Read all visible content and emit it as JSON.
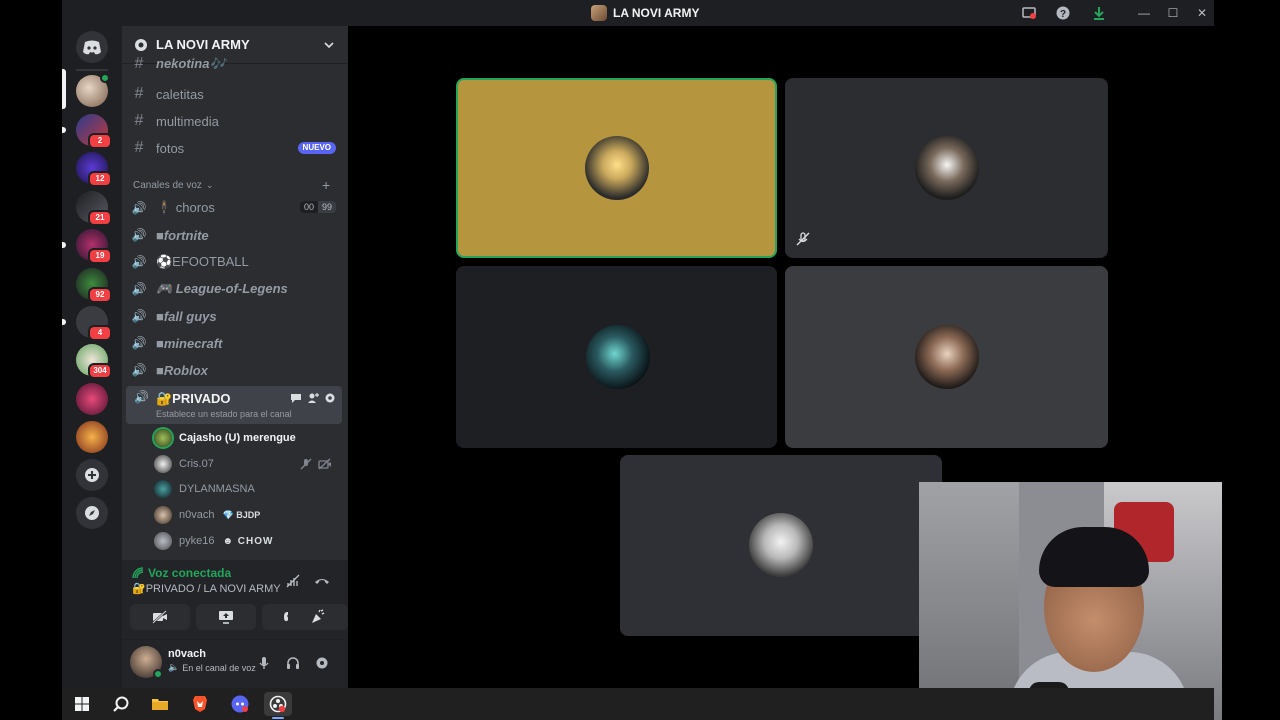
{
  "window": {
    "title": "LA NOVI ARMY"
  },
  "server": {
    "name": "LA NOVI ARMY"
  },
  "rail": {
    "servers": [
      {
        "name": "server-1",
        "badge": ""
      },
      {
        "name": "server-2",
        "badge": "2"
      },
      {
        "name": "server-3",
        "badge": "12"
      },
      {
        "name": "server-4",
        "badge": "21"
      },
      {
        "name": "server-5",
        "badge": "19"
      },
      {
        "name": "server-6",
        "badge": "92"
      },
      {
        "name": "server-7",
        "badge": "4"
      },
      {
        "name": "server-8",
        "badge": "304"
      },
      {
        "name": "server-9",
        "badge": ""
      },
      {
        "name": "server-10",
        "badge": ""
      }
    ]
  },
  "text_channels": [
    {
      "label": "nekotina🎶"
    },
    {
      "label": "caletitas"
    },
    {
      "label": "multimedia"
    },
    {
      "label": "fotos",
      "tag": "NUEVO"
    }
  ],
  "voice_category": {
    "label": "Canales de voz",
    "chevron": "⌄"
  },
  "voice_channels": [
    {
      "label": "🕴 choros",
      "count_a": "00",
      "count_b": "99"
    },
    {
      "label": "■fortnite"
    },
    {
      "label": "⚽EFOOTBALL"
    },
    {
      "label": "🎮 League-of-Legens"
    },
    {
      "label": "■fall guys"
    },
    {
      "label": "■minecraft"
    },
    {
      "label": "■Roblox"
    }
  ],
  "active_channel": {
    "label": "🔐PRIVADO",
    "status_placeholder": "Establece un estado para el canal"
  },
  "members": [
    {
      "name": "Cajasho (U) merengue",
      "tag": ""
    },
    {
      "name": "Cris.07",
      "tag": ""
    },
    {
      "name": "DYLANMASNA",
      "tag": ""
    },
    {
      "name": "n0vach",
      "tag": "BJDP"
    },
    {
      "name": "pyke16",
      "tag": "CHOW"
    }
  ],
  "voice_status": {
    "state": "Voz conectada",
    "location": "🔐PRIVADO / LA NOVI ARMY"
  },
  "user": {
    "name": "n0vach",
    "status": "En el canal de voz"
  },
  "colors": {
    "accent": "#23a55a",
    "speaking_tile": "#b6953f",
    "tile_dark": "#2b2d31",
    "tile_gray": "#3b3c40",
    "badge": "#f23f43",
    "nuevo_tag": "#5865f2"
  },
  "icons": [
    "discord-icon",
    "add-server-icon",
    "explore-icon",
    "settings-icon",
    "microphone-icon",
    "headphones-icon",
    "disconnect-icon",
    "camera-off-icon",
    "screenshare-icon",
    "activity-icon",
    "soundboard-icon",
    "inbox-icon",
    "help-icon",
    "download-icon"
  ]
}
